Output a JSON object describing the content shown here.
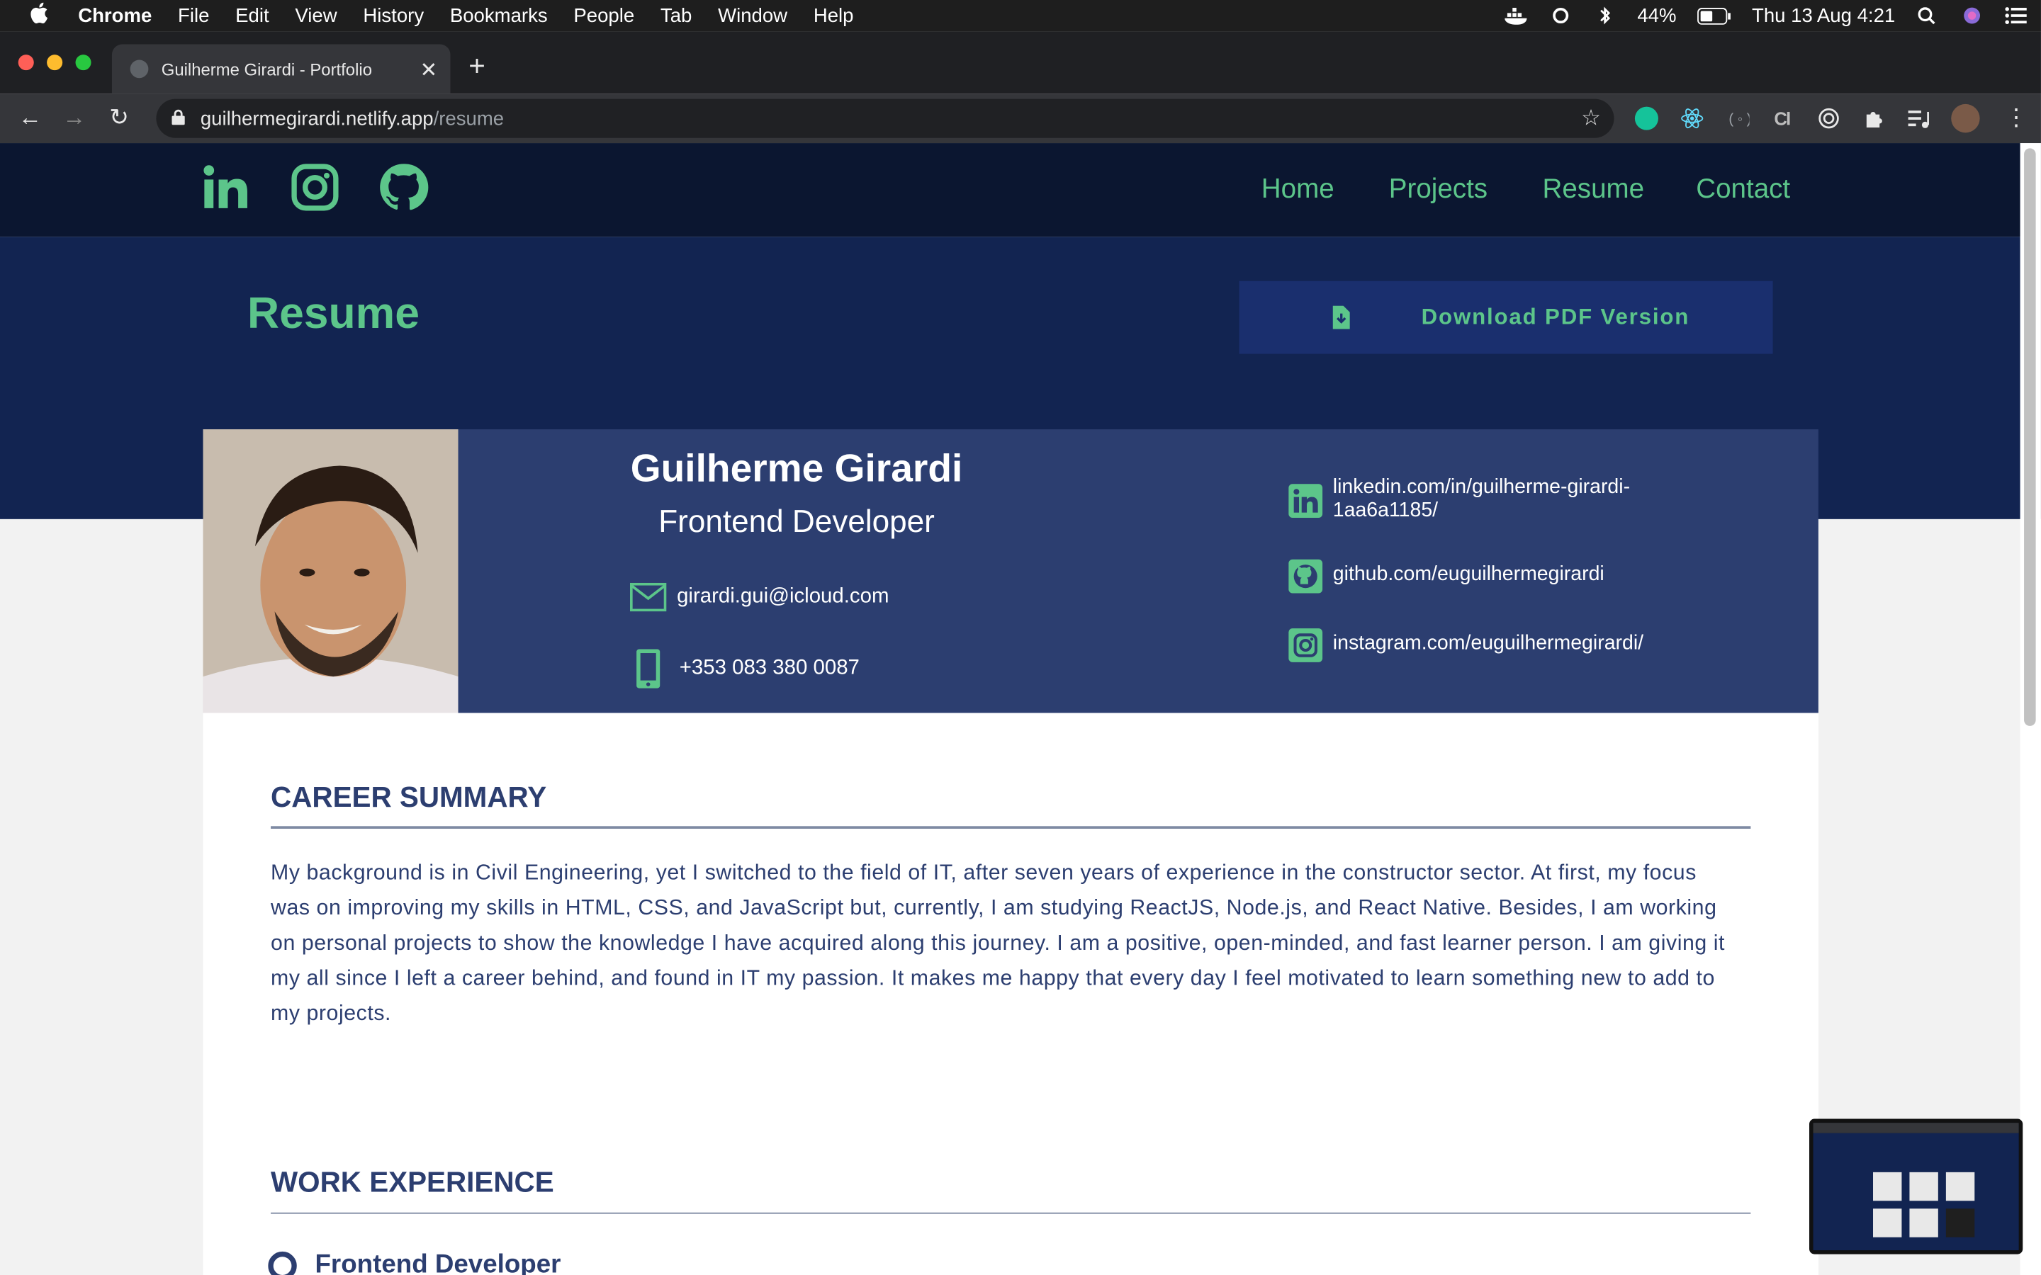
{
  "menubar": {
    "app": "Chrome",
    "items": [
      "File",
      "Edit",
      "View",
      "History",
      "Bookmarks",
      "People",
      "Tab",
      "Window",
      "Help"
    ],
    "battery": "44%",
    "datetime": "Thu 13 Aug  4:21"
  },
  "browser": {
    "tab_title": "Guilherme Girardi - Portfolio",
    "url_host": "guilhermegirardi.netlify.app",
    "url_path": "/resume"
  },
  "nav": {
    "links": [
      "Home",
      "Projects",
      "Resume",
      "Contact"
    ]
  },
  "hero": {
    "title": "Resume",
    "download_label": "Download PDF Version"
  },
  "profile": {
    "name": "Guilherme Girardi",
    "role": "Frontend Developer",
    "email": "girardi.gui@icloud.com",
    "phone": "+353 083 380 0087",
    "linkedin": "linkedin.com/in/guilherme-girardi-1aa6a1185/",
    "github": "github.com/euguilhermegirardi",
    "instagram": "instagram.com/euguilhermegirardi/"
  },
  "summary": {
    "title": "CAREER SUMMARY",
    "text": "My background is in Civil Engineering, yet I switched to the field of IT, after seven years of experience in the constructor sector. At first, my focus was on improving my skills in HTML, CSS, and JavaScript but, currently, I am studying ReactJS, Node.js, and React Native. Besides, I am working on personal projects to show the knowledge I have acquired along this journey. I am a positive, open-minded, and fast learner person. I am giving it my all since I left a career behind, and found in IT my passion. It makes me happy that every day I feel motivated to learn something new to add to my projects."
  },
  "experience": {
    "title": "WORK EXPERIENCE",
    "first_item": "Frontend Developer"
  },
  "colors": {
    "accent": "#5cc58a",
    "nav_bg": "#0b1630",
    "hero_bg": "#122451",
    "card_bg": "#2c3e70"
  }
}
